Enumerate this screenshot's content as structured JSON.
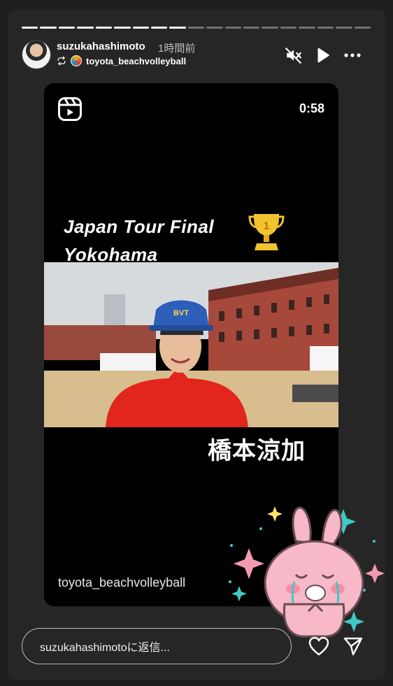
{
  "story": {
    "progress_total": 19,
    "progress_done": 9,
    "username": "suzukahashimoto",
    "time_ago": "1時間前",
    "reposted_from": "toyota_beachvolleyball"
  },
  "reel": {
    "duration": "0:58",
    "headline_line1": "Japan Tour Final",
    "headline_line2": "Yokohama",
    "cap_text": "BVT",
    "caption_name": "橋本涼加",
    "account_overlay": "toyota_beachvolleyball"
  },
  "reply": {
    "placeholder": "suzukahashimotoに返信..."
  },
  "icons": {
    "mute": "speaker-muted-icon",
    "play": "play-icon",
    "more": "more-options-icon",
    "like": "heart-icon",
    "send": "paper-plane-icon"
  },
  "colors": {
    "background": "#1f1f1f",
    "panel": "#262626",
    "shirt": "#e3261d",
    "cap": "#2d5fb9",
    "trophy": "#f2c230"
  }
}
